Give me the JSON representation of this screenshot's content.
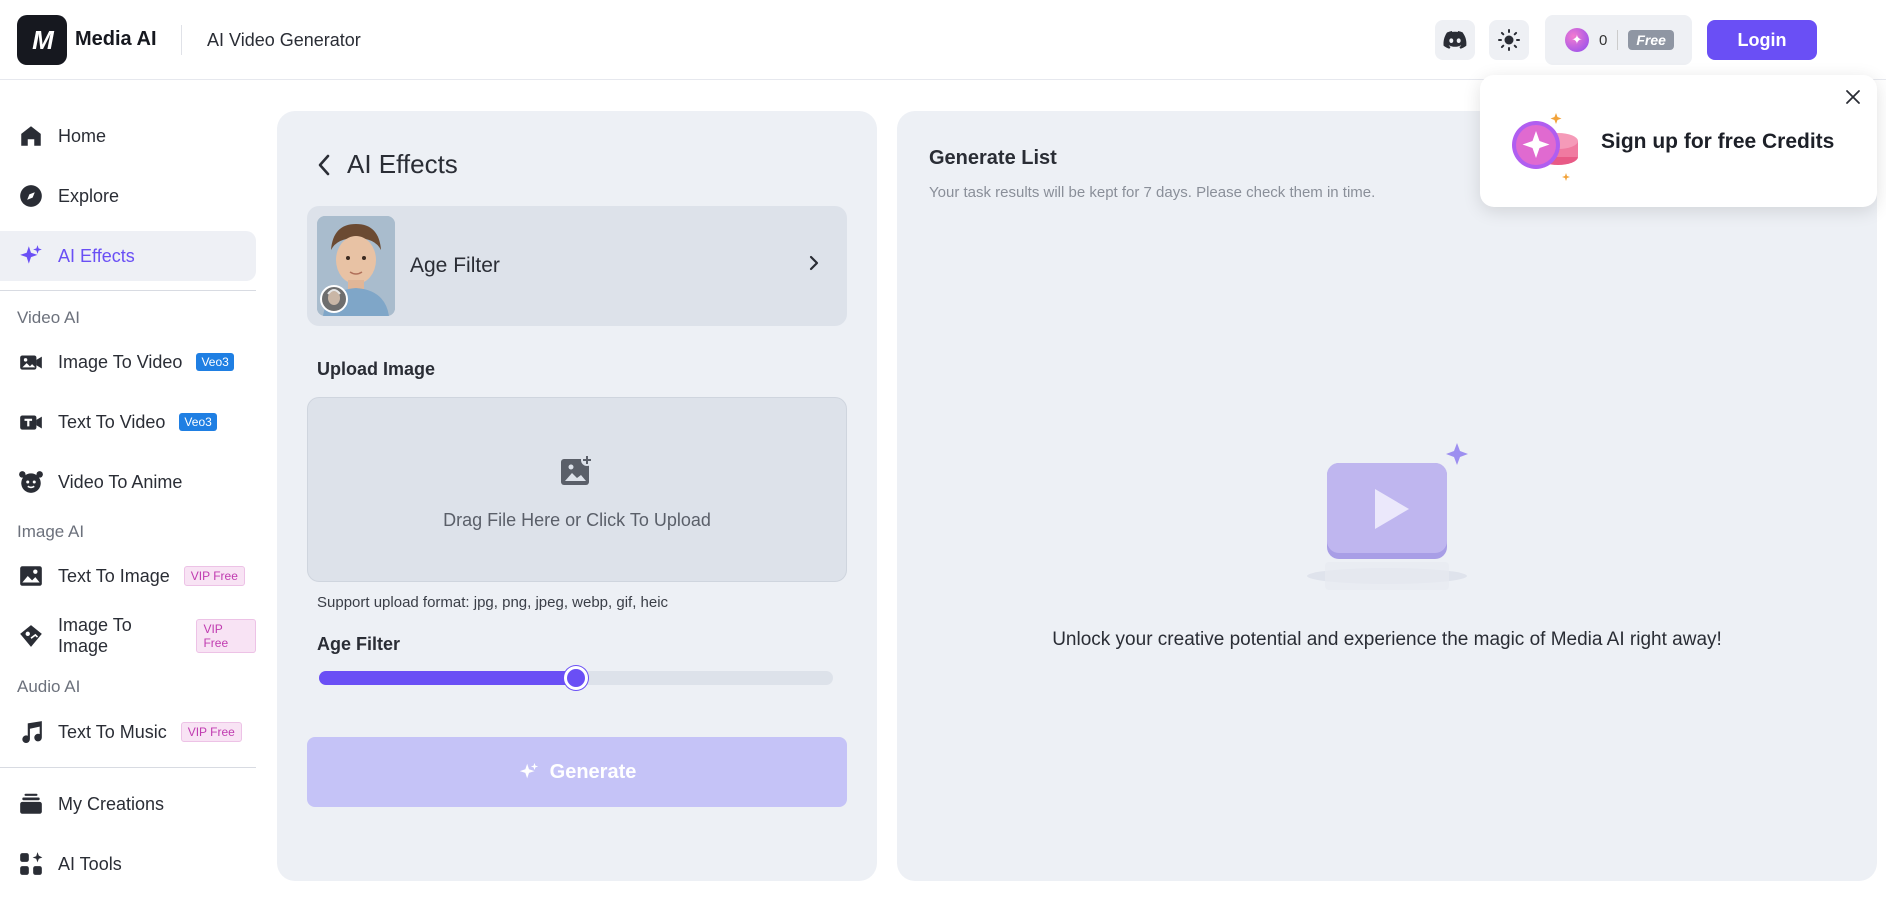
{
  "header": {
    "brand": "Media AI",
    "app_title": "AI Video Generator",
    "credits_value": "0",
    "free_label": "Free",
    "login_label": "Login"
  },
  "sidebar": {
    "items": [
      {
        "label": "Home"
      },
      {
        "label": "Explore"
      },
      {
        "label": "AI Effects"
      }
    ],
    "sections": {
      "video": "Video AI",
      "image": "Image AI",
      "audio": "Audio AI"
    },
    "video_items": [
      {
        "label": "Image To Video",
        "tag": "Veo3"
      },
      {
        "label": "Text To Video",
        "tag": "Veo3"
      },
      {
        "label": "Video To Anime"
      }
    ],
    "image_items": [
      {
        "label": "Text To Image",
        "tag": "VIP Free"
      },
      {
        "label": "Image To Image",
        "tag": "VIP Free"
      }
    ],
    "audio_items": [
      {
        "label": "Text To Music",
        "tag": "VIP Free"
      }
    ],
    "bottom_items": [
      {
        "label": "My Creations"
      },
      {
        "label": "AI Tools"
      }
    ]
  },
  "effects_panel": {
    "title": "AI Effects",
    "effect_name": "Age Filter",
    "upload_label": "Upload Image",
    "dropzone_text": "Drag File Here or Click To Upload",
    "support_text": "Support upload format: jpg, png, jpeg, webp, gif, heic",
    "slider_label": "Age Filter",
    "slider_value": 0.5,
    "generate_label": "Generate"
  },
  "generate_list": {
    "title": "Generate List",
    "subtitle": "Your task results will be kept for 7 days. Please check them in time.",
    "empty_text": "Unlock your creative potential and experience the magic of Media AI right away!"
  },
  "popup": {
    "text": "Sign up for free Credits"
  },
  "colors": {
    "accent": "#6a4ff5",
    "panel_bg": "#edf0f5"
  }
}
